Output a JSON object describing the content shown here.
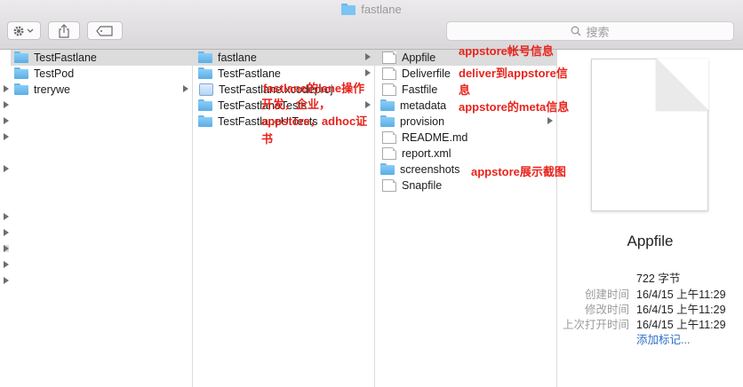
{
  "window": {
    "title": "fastlane"
  },
  "toolbar": {
    "search_placeholder": "搜索"
  },
  "columns": {
    "col1": [
      {
        "label": "TestFastlane",
        "type": "folder",
        "selected": true,
        "has_children": false
      },
      {
        "label": "TestPod",
        "type": "folder",
        "selected": false,
        "has_children": false
      },
      {
        "label": "trerywe",
        "type": "folder",
        "selected": false,
        "has_children": true
      }
    ],
    "col2": [
      {
        "label": "fastlane",
        "type": "folder",
        "selected": true,
        "has_children": true
      },
      {
        "label": "TestFastlane",
        "type": "folder",
        "selected": false,
        "has_children": true
      },
      {
        "label": "TestFastlane.xcodeproj",
        "type": "app",
        "selected": false,
        "has_children": false
      },
      {
        "label": "TestFastlaneTests",
        "type": "folder",
        "selected": false,
        "has_children": true
      },
      {
        "label": "TestFastlaneUITests",
        "type": "folder",
        "selected": false,
        "has_children": true
      }
    ],
    "col3": [
      {
        "label": "Appfile",
        "type": "doc",
        "selected": true,
        "has_children": false
      },
      {
        "label": "Deliverfile",
        "type": "doc",
        "selected": false,
        "has_children": false
      },
      {
        "label": "Fastfile",
        "type": "doc",
        "selected": false,
        "has_children": false
      },
      {
        "label": "metadata",
        "type": "folder",
        "selected": false,
        "has_children": false
      },
      {
        "label": "provision",
        "type": "folder",
        "selected": false,
        "has_children": true
      },
      {
        "label": "README.md",
        "type": "doc",
        "selected": false,
        "has_children": false
      },
      {
        "label": "report.xml",
        "type": "doc",
        "selected": false,
        "has_children": false
      },
      {
        "label": "screenshots",
        "type": "folder",
        "selected": false,
        "has_children": false
      },
      {
        "label": "Snapfile",
        "type": "doc",
        "selected": false,
        "has_children": false
      }
    ]
  },
  "annotations": {
    "appfile": "appstore帐号信息",
    "deliverfile_1": "deliver到appstore信",
    "deliverfile_2": "息",
    "metadata": "appstore的meta信息",
    "screenshots": "appstore展示截图",
    "fastfile_1": "fastlane的lane操作",
    "fastfile_2": "开发，企业，",
    "fastfile_3": "appstore，adhoc证",
    "fastfile_4": "书"
  },
  "preview": {
    "name": "Appfile",
    "size": "722 字节",
    "rows": [
      {
        "key": "创建时间",
        "value": "16/4/15 上午11:29"
      },
      {
        "key": "修改时间",
        "value": "16/4/15 上午11:29"
      },
      {
        "key": "上次打开时间",
        "value": "16/4/15 上午11:29"
      }
    ],
    "add_tag": "添加标记..."
  },
  "colors": {
    "annotation": "#e8231c",
    "selection": "#dcdcdc",
    "folder": "#66b8ec",
    "link": "#2f6ec8"
  }
}
